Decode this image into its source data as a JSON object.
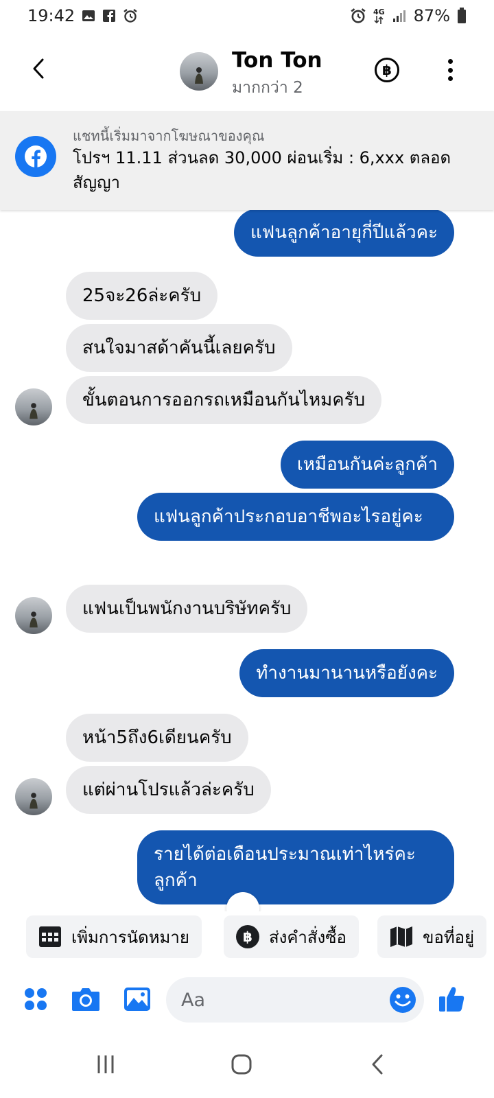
{
  "status_bar": {
    "time": "19:42",
    "battery": "87%",
    "network": "4G"
  },
  "header": {
    "name": "Ton Ton",
    "subtitle": "มากกว่า 2"
  },
  "ad_banner": {
    "label": "แชทนี้เริ่มมาจากโฆษณาของคุณ",
    "text": "โปรฯ 11.11 ส่วนลด 30,000 ผ่อนเริ่ม : 6,xxx ตลอดสัญญา"
  },
  "messages": [
    {
      "side": "out",
      "text": "แฟนลูกค้าอายุกี่ปีแล้วคะ"
    },
    {
      "side": "in",
      "text": "25จะ26ล่ะครับ"
    },
    {
      "side": "in",
      "text": "สนใจมาสด้าคันนี้เลยครับ"
    },
    {
      "side": "in",
      "text": "ขั้นตอนการออกรถเหมือนกันไหมครับ"
    },
    {
      "side": "out",
      "text": "เหมือนกันค่ะลูกค้า"
    },
    {
      "side": "out",
      "text": "แฟนลูกค้าประกอบอาชีพอะไรอยู่คะ"
    },
    {
      "side": "in",
      "text": "แฟนเป็นพนักงานบริษัทครับ"
    },
    {
      "side": "out",
      "text": "ทำงานมานานหรือยังคะ"
    },
    {
      "side": "in",
      "text": "หน้า5ถึง6เดียนครับ"
    },
    {
      "side": "in",
      "text": "แต่ผ่านโปรแล้วล่ะครับ"
    },
    {
      "side": "out",
      "text": "รายได้ต่อเดือนประมาณเท่าไหร่คะลูกค้า"
    }
  ],
  "quick_replies": [
    {
      "label": "เพิ่มการนัดหมาย",
      "icon": "calendar-icon"
    },
    {
      "label": "ส่งคำสั่งซื้อ",
      "icon": "baht-icon"
    },
    {
      "label": "ขอที่อยู่",
      "icon": "map-icon"
    }
  ],
  "composer": {
    "placeholder": "Aa"
  },
  "colors": {
    "accent": "#1877f2",
    "outgoing_bubble": "#1456b0",
    "incoming_bubble": "#e9e9eb"
  }
}
